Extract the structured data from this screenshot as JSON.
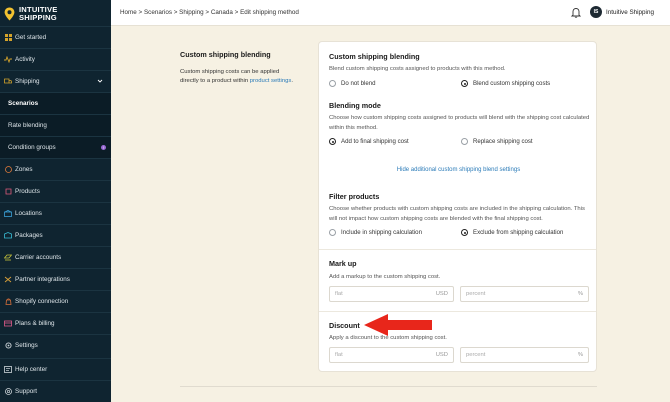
{
  "brand": {
    "line1": "Intuitive",
    "line2": "Shipping"
  },
  "colors": {
    "sidebar": "#0f2430",
    "accent_link": "#2b7bb8",
    "background": "#f6f1e3",
    "annotation_arrow": "#e8261b",
    "badge": "#9b6bd6"
  },
  "sidebar": {
    "items": [
      {
        "label": "Get started",
        "icon": "grid-icon"
      },
      {
        "label": "Activity",
        "icon": "activity-icon"
      },
      {
        "label": "Shipping",
        "icon": "shipping-icon"
      },
      {
        "label": "Scenarios"
      },
      {
        "label": "Rate blending"
      },
      {
        "label": "Condition groups",
        "badge": "!"
      },
      {
        "label": "Zones",
        "icon": "zones-icon"
      },
      {
        "label": "Products",
        "icon": "products-icon"
      },
      {
        "label": "Locations",
        "icon": "location-icon"
      },
      {
        "label": "Packages",
        "icon": "package-icon"
      },
      {
        "label": "Carrier accounts",
        "icon": "carrier-icon"
      },
      {
        "label": "Partner integrations",
        "icon": "integrations-icon"
      },
      {
        "label": "Shopify connection",
        "icon": "shopify-icon"
      },
      {
        "label": "Plans & billing",
        "icon": "billing-icon"
      },
      {
        "label": "Settings",
        "icon": "gear-icon"
      }
    ],
    "bottom": [
      {
        "label": "Help center",
        "icon": "help-icon"
      },
      {
        "label": "Support",
        "icon": "support-icon"
      }
    ]
  },
  "topbar": {
    "breadcrumb": "Home > Scenarios > Shipping > Canada > Edit shipping method",
    "avatar_initials": "IS",
    "account_name": "Intuitive Shipping"
  },
  "description": {
    "title": "Custom shipping blending",
    "body": "Custom shipping costs can be applied directly to a product within",
    "link": "product settings",
    "end": "."
  },
  "card": {
    "blending": {
      "title": "Custom shipping blending",
      "text": "Blend custom shipping costs assigned to products with this method.",
      "option_a": "Do not blend",
      "option_b": "Blend custom shipping costs",
      "selected": "option_b"
    },
    "mode": {
      "title": "Blending mode",
      "text": "Choose how custom shipping costs assigned to products will blend with the shipping cost calculated within this method.",
      "option_a": "Add to final shipping cost",
      "option_b": "Replace shipping cost",
      "selected": "option_a"
    },
    "hide_link": "Hide additional custom shipping blend settings",
    "filter": {
      "title": "Filter products",
      "text": "Choose whether products with custom shipping costs are included in the shipping calculation. This will not impact how custom shipping costs are blended with the final shipping cost.",
      "option_a": "Include in shipping calculation",
      "option_b": "Exclude from shipping calculation",
      "selected": "option_b"
    },
    "markup": {
      "title": "Mark up",
      "text": "Add a markup to the custom shipping cost.",
      "flat_placeholder": "flat",
      "flat_suffix": "USD",
      "percent_placeholder": "percent",
      "percent_suffix": "%"
    },
    "discount": {
      "title": "Discount",
      "text": "Apply a discount to the custom shipping cost.",
      "flat_placeholder": "flat",
      "flat_suffix": "USD",
      "percent_placeholder": "percent",
      "percent_suffix": "%"
    }
  }
}
